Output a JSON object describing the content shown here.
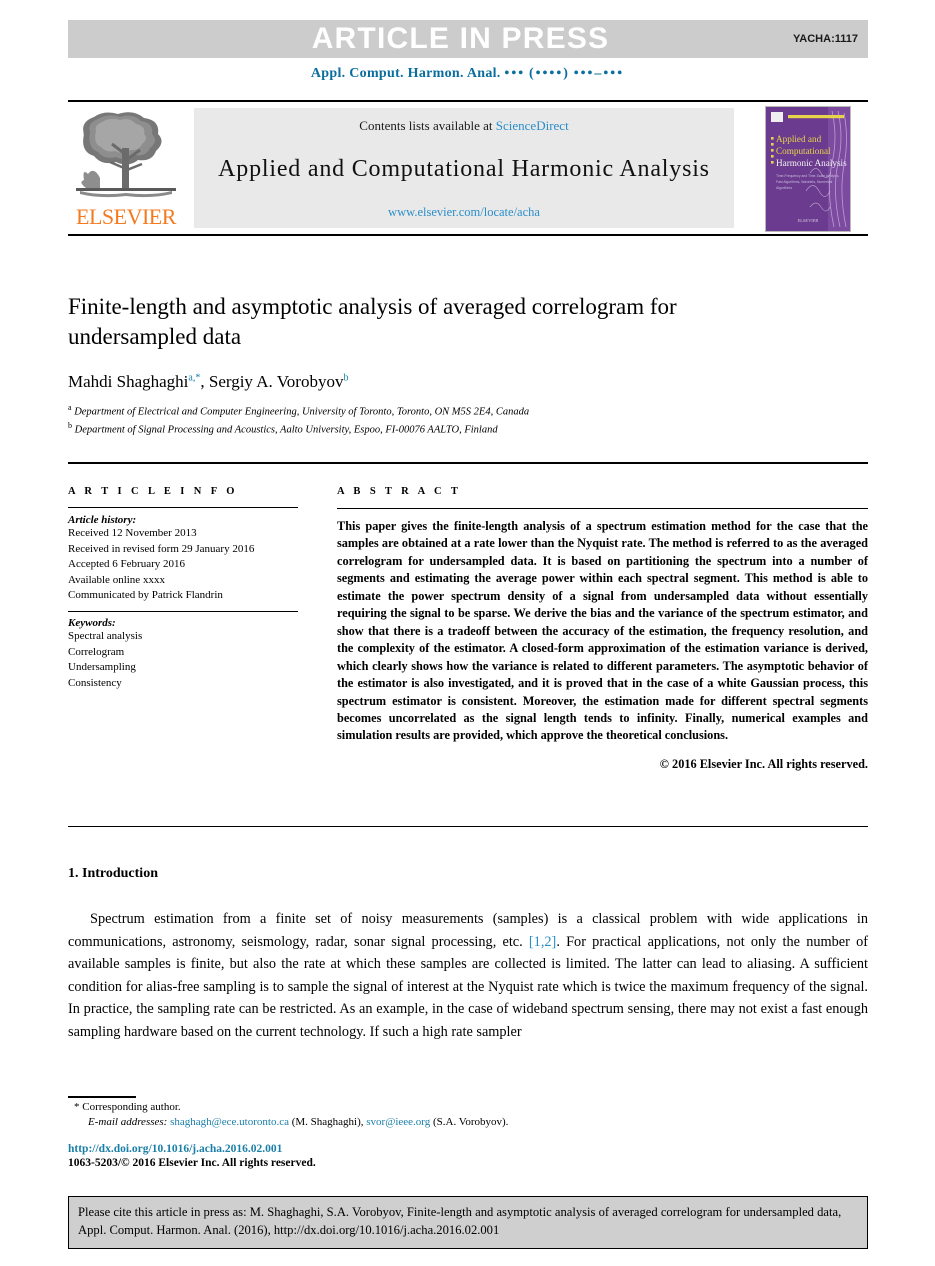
{
  "header": {
    "article_in_press": "ARTICLE IN PRESS",
    "manuscript_code": "YACHA:1117",
    "journal_ref_prefix": "Appl. Comput. Harmon. Anal.",
    "journal_ref_volume": "•••",
    "journal_ref_year": "(••••)",
    "journal_ref_pages": "•••–•••",
    "band_color": "#cccccc",
    "link_color": "#2a8ec9"
  },
  "masthead": {
    "publisher_name": "ELSEVIER",
    "publisher_color": "#f47a20",
    "contents_prefix": "Contents lists available at",
    "contents_link": "ScienceDirect",
    "journal_title": "Applied and Computational Harmonic Analysis",
    "journal_url": "www.elsevier.com/locate/acha",
    "cover": {
      "title_line1": "Applied and",
      "title_line2": "Computational",
      "title_line3": "Harmonic Analysis",
      "background": "#6a3b8e",
      "accent": "#e8d44a"
    }
  },
  "article": {
    "title": "Finite-length and asymptotic analysis of averaged correlogram for undersampled data",
    "authors_html": "Mahdi Shaghaghi<sup>a,*</sup>, Sergiy A. Vorobyov<sup>b</sup>",
    "affiliations": [
      "Department of Electrical and Computer Engineering, University of Toronto, Toronto, ON M5S 2E4, Canada",
      "Department of Signal Processing and Acoustics, Aalto University, Espoo, FI-00076 AALTO, Finland"
    ],
    "affiliation_marks": [
      "a",
      "b"
    ]
  },
  "article_info": {
    "heading": "A R T I C L E   I N F O",
    "history_label": "Article history:",
    "history_lines": [
      "Received 12 November 2013",
      "Received in revised form 29 January 2016",
      "Accepted 6 February 2016",
      "Available online xxxx",
      "Communicated by Patrick Flandrin"
    ],
    "keywords_label": "Keywords:",
    "keywords": [
      "Spectral analysis",
      "Correlogram",
      "Undersampling",
      "Consistency"
    ]
  },
  "abstract": {
    "heading": "A B S T R A C T",
    "text": "This paper gives the finite-length analysis of a spectrum estimation method for the case that the samples are obtained at a rate lower than the Nyquist rate. The method is referred to as the averaged correlogram for undersampled data. It is based on partitioning the spectrum into a number of segments and estimating the average power within each spectral segment. This method is able to estimate the power spectrum density of a signal from undersampled data without essentially requiring the signal to be sparse. We derive the bias and the variance of the spectrum estimator, and show that there is a tradeoff between the accuracy of the estimation, the frequency resolution, and the complexity of the estimator. A closed-form approximation of the estimation variance is derived, which clearly shows how the variance is related to different parameters. The asymptotic behavior of the estimator is also investigated, and it is proved that in the case of a white Gaussian process, this spectrum estimator is consistent. Moreover, the estimation made for different spectral segments becomes uncorrelated as the signal length tends to infinity. Finally, numerical examples and simulation results are provided, which approve the theoretical conclusions.",
    "copyright": "© 2016 Elsevier Inc. All rights reserved."
  },
  "body": {
    "section_number_title": "1. Introduction",
    "paragraph_1_pre": "Spectrum estimation from a finite set of noisy measurements (samples) is a classical problem with wide applications in communications, astronomy, seismology, radar, sonar signal processing, etc. ",
    "paragraph_1_ref": "[1,2]",
    "paragraph_1_post": ". For practical applications, not only the number of available samples is finite, but also the rate at which these samples are collected is limited. The latter can lead to aliasing. A sufficient condition for alias-free sampling is to sample the signal of interest at the Nyquist rate which is twice the maximum frequency of the signal. In practice, the sampling rate can be restricted. As an example, in the case of wideband spectrum sensing, there may not exist a fast enough sampling hardware based on the current technology. If such a high rate sampler"
  },
  "footnotes": {
    "corresponding_marker": "*",
    "corresponding_text": "Corresponding author.",
    "email_label": "E-mail addresses:",
    "email_1": "shaghagh@ece.utoronto.ca",
    "email_1_owner": "(M. Shaghaghi),",
    "email_2": "svor@ieee.org",
    "email_2_owner": "(S.A. Vorobyov).",
    "doi": "http://dx.doi.org/10.1016/j.acha.2016.02.001",
    "issn_copyright": "1063-5203/© 2016 Elsevier Inc. All rights reserved."
  },
  "cite_box": {
    "text": "Please cite this article in press as: M. Shaghaghi, S.A. Vorobyov, Finite-length and asymptotic analysis of averaged correlogram for undersampled data, Appl. Comput. Harmon. Anal. (2016), http://dx.doi.org/10.1016/j.acha.2016.02.001"
  }
}
